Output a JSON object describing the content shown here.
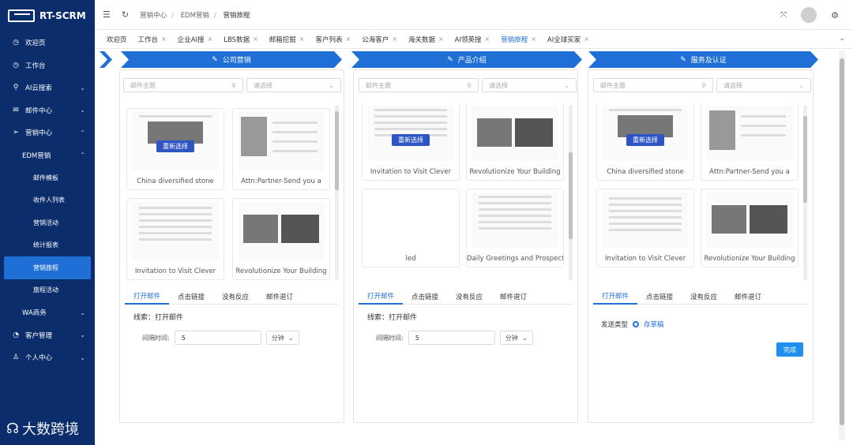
{
  "app": {
    "name": "RT-SCRM"
  },
  "sidebar": {
    "items": [
      {
        "label": "欢迎页",
        "icon": "clock-icon",
        "level": 0,
        "caret": ""
      },
      {
        "label": "工作台",
        "icon": "clock-icon",
        "level": 0,
        "caret": ""
      },
      {
        "label": "AI云搜索",
        "icon": "search-icon",
        "level": 0,
        "caret": "⌄"
      },
      {
        "label": "邮件中心",
        "icon": "mail-icon",
        "level": 0,
        "caret": "⌄"
      },
      {
        "label": "营销中心",
        "icon": "send-icon",
        "level": 0,
        "caret": "⌃"
      },
      {
        "label": "EDM营销",
        "icon": "",
        "level": 1,
        "caret": "⌃"
      },
      {
        "label": "邮件模板",
        "icon": "",
        "level": 2,
        "caret": ""
      },
      {
        "label": "收件人列表",
        "icon": "",
        "level": 2,
        "caret": ""
      },
      {
        "label": "营销活动",
        "icon": "",
        "level": 2,
        "caret": ""
      },
      {
        "label": "统计报表",
        "icon": "",
        "level": 2,
        "caret": ""
      },
      {
        "label": "营销旅程",
        "icon": "",
        "level": 2,
        "caret": "",
        "active": true
      },
      {
        "label": "旅程活动",
        "icon": "",
        "level": 2,
        "caret": ""
      },
      {
        "label": "WA商务",
        "icon": "",
        "level": 1,
        "caret": "⌄"
      },
      {
        "label": "客户管理",
        "icon": "customer-icon",
        "level": 0,
        "caret": "⌄"
      },
      {
        "label": "个人中心",
        "icon": "person-icon",
        "level": 0,
        "caret": "⌄"
      }
    ],
    "watermark": "大数跨境"
  },
  "breadcrumb": [
    "营销中心",
    "EDM营销",
    "营销旅程"
  ],
  "tabs": [
    {
      "label": "欢迎页",
      "closable": false
    },
    {
      "label": "工作台",
      "closable": true
    },
    {
      "label": "企业AI搜",
      "closable": true
    },
    {
      "label": "LBS数据",
      "closable": true
    },
    {
      "label": "邮箱挖掘",
      "closable": true
    },
    {
      "label": "客户列表",
      "closable": true
    },
    {
      "label": "公海客户",
      "closable": true
    },
    {
      "label": "海关数据",
      "closable": true
    },
    {
      "label": "AI领英搜",
      "closable": true
    },
    {
      "label": "营销旅程",
      "closable": true,
      "active": true
    },
    {
      "label": "AI全球买家",
      "closable": true
    }
  ],
  "steps": [
    {
      "label": "公司营销"
    },
    {
      "label": "产品介绍"
    },
    {
      "label": "服务及认证"
    }
  ],
  "filter": {
    "subject_placeholder": "邮件主题",
    "select_placeholder": "请选择"
  },
  "reselect_label": "重新选择",
  "columns": [
    {
      "cards": [
        "China diversified stone",
        "Attn:Partner-Send you a",
        "Invitation to Visit Clever",
        "Revolutionize Your Building"
      ]
    },
    {
      "cards": [
        "Invitation to Visit Clever",
        "Revolutionize Your Building",
        "led",
        "Daily Greetings and Prospects"
      ]
    },
    {
      "cards": [
        "China diversified stone",
        "Attn:Partner-Send you a",
        "Invitation to Visit Clever",
        "Revolutionize Your Building"
      ]
    }
  ],
  "subtabs": [
    "打开邮件",
    "点击链接",
    "没有反应",
    "邮件退订"
  ],
  "clue": "线索：打开邮件",
  "interval": {
    "label": "间隔时间:",
    "value": "5",
    "unit": "分钟"
  },
  "send_type": {
    "label": "发送类型",
    "option": "存草稿"
  },
  "done_label": "完成"
}
